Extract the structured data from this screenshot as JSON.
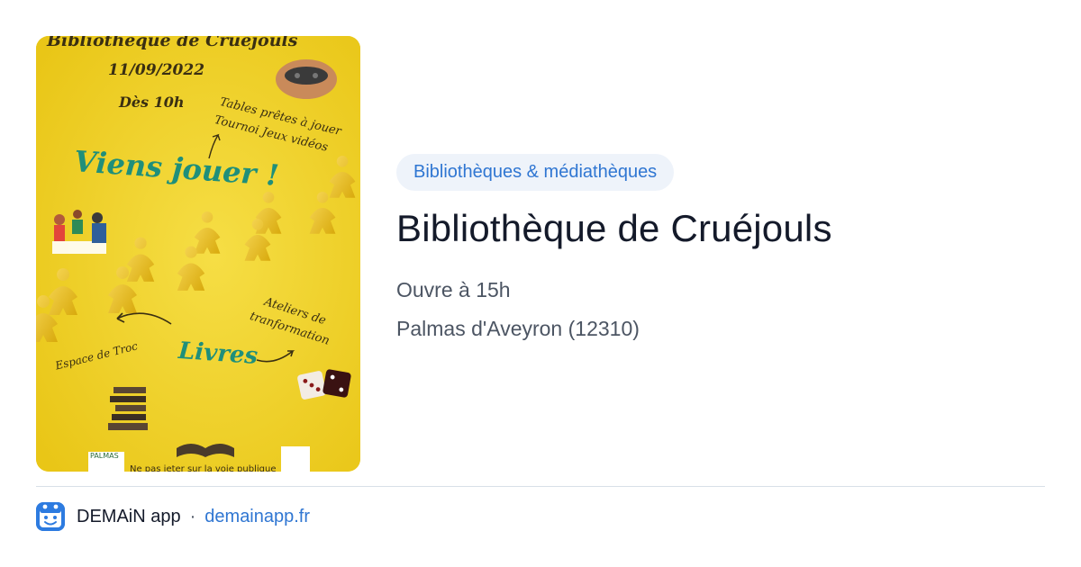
{
  "poster": {
    "title": "Bibliothèque de Cruéjouls",
    "date": "11/09/2022",
    "hour": "Dès 10h",
    "tables": "Tables prêtes à jouer",
    "tournoi": "Tournoi Jeux vidéos",
    "viens": "Viens jouer !",
    "ateliers": "Ateliers de",
    "transformation": "tranformation",
    "troc": "Espace de Troc",
    "livres": "Livres",
    "bottom": "Ne pas jeter sur la voie publique",
    "logo_text": "PALMAS"
  },
  "category": "Bibliothèques & médiathèques",
  "title": "Bibliothèque de Cruéjouls",
  "opening": "Ouvre à 15h",
  "location": "Palmas d'Aveyron (12310)",
  "footer": {
    "app_name": "DEMAiN app",
    "separator": "·",
    "domain": "demainapp.fr"
  },
  "colors": {
    "accent": "#2f76d2",
    "chip_bg": "#eef3fa",
    "poster_bg": "#f1d32a",
    "poster_green": "#1f8f7a"
  }
}
